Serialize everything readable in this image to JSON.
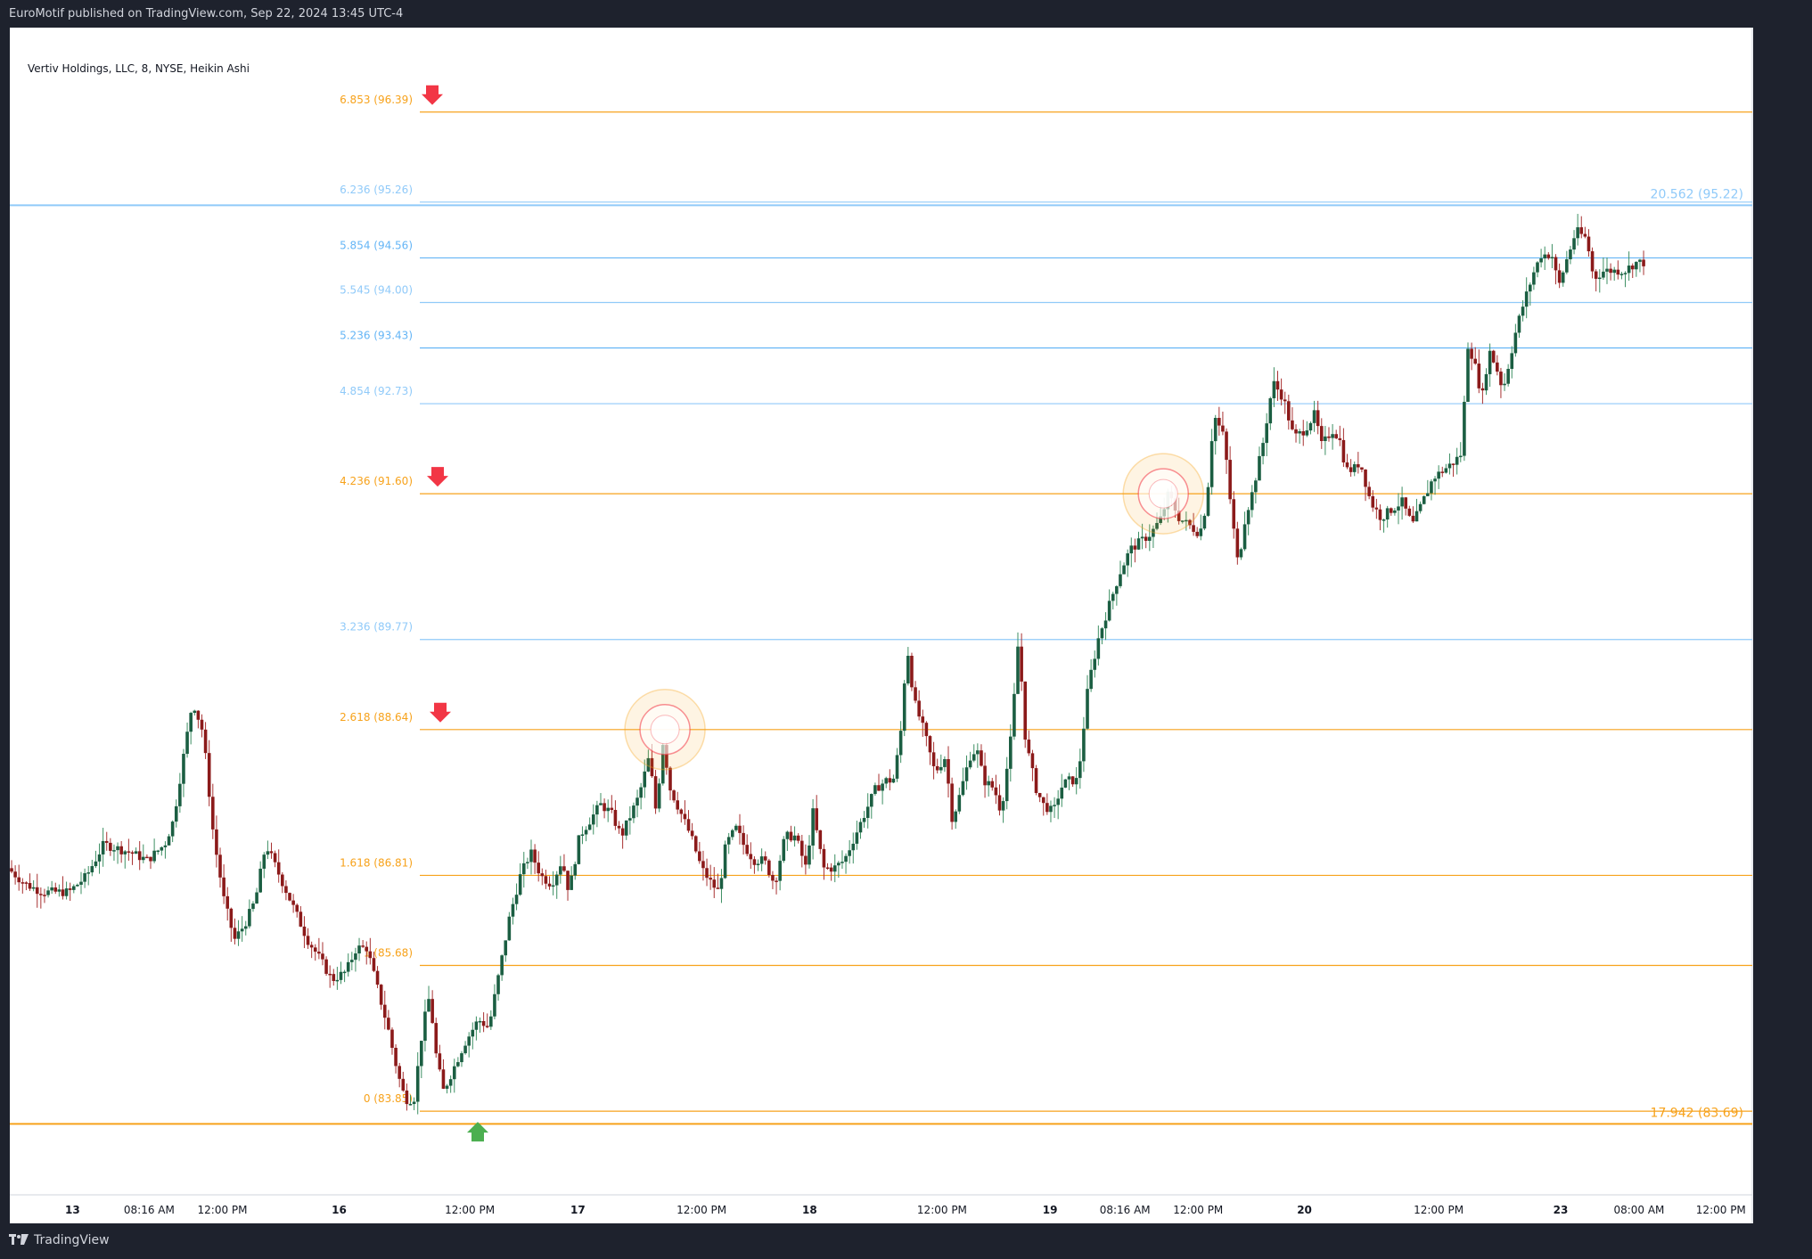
{
  "header": {
    "published_text": "EuroMotif published on TradingView.com, Sep 22, 2024 13:45 UTC-4"
  },
  "footer": {
    "brand": "TradingView",
    "logo_icon": "tradingview-logo-icon"
  },
  "symbol_info": "Vertiv Holdings, LLC, 8, NYSE, Heikin Ashi",
  "colors": {
    "up": "#26a69a",
    "up_dark": "#1b5e42",
    "down": "#8b1a1a",
    "fib_orange": "#f7a21b",
    "fib_blue": "#64b5f6",
    "fib_light_blue": "#90caf9",
    "arrow_red": "#f23645",
    "arrow_green": "#4caf50"
  },
  "chart_data": {
    "type": "candlestick",
    "chart_style": "Heikin Ashi",
    "interval": "8",
    "y_axis": {
      "position": "right",
      "range": [
        82.8,
        97.45
      ],
      "ticks": [
        "97.00",
        "96.50",
        "96.00",
        "95.50",
        "95.00",
        "94.50",
        "94.00",
        "93.50",
        "93.00",
        "92.50",
        "92.00",
        "91.50",
        "91.00",
        "90.50",
        "90.00",
        "89.50",
        "89.00",
        "88.50",
        "88.00",
        "87.50",
        "87.00",
        "86.50",
        "86.00",
        "85.50",
        "85.00",
        "84.50",
        "84.00",
        "83.50",
        "83.00"
      ]
    },
    "x_axis": {
      "ticks": [
        {
          "label": "13",
          "bold": true,
          "pos": 0.036
        },
        {
          "label": "08:16 AM",
          "bold": false,
          "pos": 0.08
        },
        {
          "label": "12:00 PM",
          "bold": false,
          "pos": 0.122
        },
        {
          "label": "16",
          "bold": true,
          "pos": 0.189
        },
        {
          "label": "12:00 PM",
          "bold": false,
          "pos": 0.264
        },
        {
          "label": "17",
          "bold": true,
          "pos": 0.326
        },
        {
          "label": "12:00 PM",
          "bold": false,
          "pos": 0.397
        },
        {
          "label": "18",
          "bold": true,
          "pos": 0.459
        },
        {
          "label": "12:00 PM",
          "bold": false,
          "pos": 0.535
        },
        {
          "label": "19",
          "bold": true,
          "pos": 0.597
        },
        {
          "label": "08:16 AM",
          "bold": false,
          "pos": 0.64
        },
        {
          "label": "12:00 PM",
          "bold": false,
          "pos": 0.682
        },
        {
          "label": "20",
          "bold": true,
          "pos": 0.743
        },
        {
          "label": "12:00 PM",
          "bold": false,
          "pos": 0.82
        },
        {
          "label": "23",
          "bold": true,
          "pos": 0.89
        },
        {
          "label": "08:00 AM",
          "bold": false,
          "pos": 0.935
        },
        {
          "label": "12:00 PM",
          "bold": false,
          "pos": 0.982
        }
      ]
    },
    "price_path": [
      [
        0.0,
        86.9
      ],
      [
        0.01,
        86.7
      ],
      [
        0.02,
        86.6
      ],
      [
        0.035,
        86.6
      ],
      [
        0.045,
        86.8
      ],
      [
        0.055,
        87.2
      ],
      [
        0.07,
        87.1
      ],
      [
        0.08,
        87.0
      ],
      [
        0.09,
        87.2
      ],
      [
        0.095,
        87.5
      ],
      [
        0.1,
        88.2
      ],
      [
        0.106,
        89.0
      ],
      [
        0.112,
        88.6
      ],
      [
        0.118,
        87.3
      ],
      [
        0.124,
        86.5
      ],
      [
        0.13,
        86.0
      ],
      [
        0.136,
        86.2
      ],
      [
        0.142,
        86.5
      ],
      [
        0.148,
        87.2
      ],
      [
        0.154,
        86.9
      ],
      [
        0.16,
        86.6
      ],
      [
        0.166,
        86.3
      ],
      [
        0.172,
        86.0
      ],
      [
        0.178,
        85.8
      ],
      [
        0.186,
        85.5
      ],
      [
        0.194,
        85.6
      ],
      [
        0.2,
        85.9
      ],
      [
        0.206,
        85.9
      ],
      [
        0.212,
        85.4
      ],
      [
        0.218,
        84.9
      ],
      [
        0.224,
        84.3
      ],
      [
        0.228,
        84.0
      ],
      [
        0.233,
        84.0
      ],
      [
        0.238,
        84.9
      ],
      [
        0.242,
        85.3
      ],
      [
        0.246,
        84.5
      ],
      [
        0.25,
        84.1
      ],
      [
        0.256,
        84.4
      ],
      [
        0.262,
        84.7
      ],
      [
        0.27,
        85.0
      ],
      [
        0.276,
        84.9
      ],
      [
        0.282,
        85.6
      ],
      [
        0.288,
        86.3
      ],
      [
        0.294,
        86.8
      ],
      [
        0.3,
        87.1
      ],
      [
        0.306,
        86.8
      ],
      [
        0.312,
        86.7
      ],
      [
        0.318,
        87.0
      ],
      [
        0.322,
        86.6
      ],
      [
        0.328,
        87.3
      ],
      [
        0.334,
        87.5
      ],
      [
        0.34,
        87.7
      ],
      [
        0.346,
        87.6
      ],
      [
        0.352,
        87.3
      ],
      [
        0.356,
        87.5
      ],
      [
        0.362,
        87.8
      ],
      [
        0.368,
        88.3
      ],
      [
        0.372,
        87.6
      ],
      [
        0.376,
        88.5
      ],
      [
        0.38,
        87.9
      ],
      [
        0.386,
        87.6
      ],
      [
        0.392,
        87.3
      ],
      [
        0.398,
        86.9
      ],
      [
        0.404,
        86.7
      ],
      [
        0.408,
        86.6
      ],
      [
        0.412,
        87.2
      ],
      [
        0.418,
        87.4
      ],
      [
        0.422,
        87.2
      ],
      [
        0.428,
        87.0
      ],
      [
        0.434,
        87.0
      ],
      [
        0.44,
        86.7
      ],
      [
        0.446,
        87.3
      ],
      [
        0.452,
        87.3
      ],
      [
        0.458,
        86.9
      ],
      [
        0.462,
        87.6
      ],
      [
        0.468,
        86.9
      ],
      [
        0.474,
        86.9
      ],
      [
        0.48,
        87.0
      ],
      [
        0.486,
        87.3
      ],
      [
        0.492,
        87.6
      ],
      [
        0.498,
        87.9
      ],
      [
        0.504,
        88.0
      ],
      [
        0.508,
        88.0
      ],
      [
        0.512,
        88.5
      ],
      [
        0.516,
        89.7
      ],
      [
        0.52,
        89.0
      ],
      [
        0.526,
        88.6
      ],
      [
        0.532,
        88.1
      ],
      [
        0.538,
        88.3
      ],
      [
        0.542,
        87.5
      ],
      [
        0.546,
        87.8
      ],
      [
        0.552,
        88.3
      ],
      [
        0.556,
        88.4
      ],
      [
        0.56,
        88.0
      ],
      [
        0.566,
        87.9
      ],
      [
        0.57,
        87.6
      ],
      [
        0.576,
        88.6
      ],
      [
        0.58,
        89.8
      ],
      [
        0.584,
        88.5
      ],
      [
        0.59,
        87.9
      ],
      [
        0.594,
        87.7
      ],
      [
        0.6,
        87.6
      ],
      [
        0.604,
        87.9
      ],
      [
        0.608,
        88.0
      ],
      [
        0.614,
        88.0
      ],
      [
        0.62,
        89.2
      ],
      [
        0.626,
        89.8
      ],
      [
        0.632,
        90.2
      ],
      [
        0.638,
        90.6
      ],
      [
        0.644,
        90.9
      ],
      [
        0.65,
        91.0
      ],
      [
        0.656,
        91.1
      ],
      [
        0.662,
        91.3
      ],
      [
        0.666,
        91.6
      ],
      [
        0.672,
        91.3
      ],
      [
        0.678,
        91.2
      ],
      [
        0.684,
        91.1
      ],
      [
        0.688,
        91.5
      ],
      [
        0.692,
        92.6
      ],
      [
        0.698,
        92.3
      ],
      [
        0.702,
        91.4
      ],
      [
        0.706,
        90.7
      ],
      [
        0.71,
        91.3
      ],
      [
        0.714,
        91.6
      ],
      [
        0.72,
        92.2
      ],
      [
        0.726,
        93.0
      ],
      [
        0.732,
        92.8
      ],
      [
        0.738,
        92.3
      ],
      [
        0.744,
        92.4
      ],
      [
        0.75,
        92.6
      ],
      [
        0.754,
        92.2
      ],
      [
        0.76,
        92.4
      ],
      [
        0.764,
        92.3
      ],
      [
        0.768,
        91.9
      ],
      [
        0.772,
        91.9
      ],
      [
        0.776,
        92.0
      ],
      [
        0.782,
        91.5
      ],
      [
        0.788,
        91.3
      ],
      [
        0.794,
        91.4
      ],
      [
        0.8,
        91.5
      ],
      [
        0.806,
        91.2
      ],
      [
        0.812,
        91.5
      ],
      [
        0.818,
        91.8
      ],
      [
        0.824,
        91.9
      ],
      [
        0.83,
        92.0
      ],
      [
        0.834,
        92.1
      ],
      [
        0.838,
        93.5
      ],
      [
        0.842,
        93.2
      ],
      [
        0.846,
        92.8
      ],
      [
        0.85,
        93.4
      ],
      [
        0.854,
        93.2
      ],
      [
        0.858,
        92.9
      ],
      [
        0.862,
        93.3
      ],
      [
        0.866,
        93.7
      ],
      [
        0.87,
        94.0
      ],
      [
        0.876,
        94.4
      ],
      [
        0.88,
        94.6
      ],
      [
        0.886,
        94.6
      ],
      [
        0.89,
        94.2
      ],
      [
        0.894,
        94.5
      ],
      [
        0.9,
        94.9
      ],
      [
        0.906,
        94.8
      ],
      [
        0.91,
        94.3
      ],
      [
        0.916,
        94.4
      ],
      [
        0.922,
        94.4
      ],
      [
        0.928,
        94.4
      ],
      [
        0.934,
        94.5
      ],
      [
        0.938,
        94.5
      ]
    ],
    "fib_levels": [
      {
        "label": "6.853 (96.39)",
        "price": 96.39,
        "color": "orange",
        "arrow": "down"
      },
      {
        "label": "6.236 (95.26)",
        "price": 95.26,
        "color": "light-blue"
      },
      {
        "label": "5.854 (94.56)",
        "price": 94.56,
        "color": "blue"
      },
      {
        "label": "5.545 (94.00)",
        "price": 94.0,
        "color": "light-blue"
      },
      {
        "label": "5.236 (93.43)",
        "price": 93.43,
        "color": "blue"
      },
      {
        "label": "4.854 (92.73)",
        "price": 92.73,
        "color": "light-blue"
      },
      {
        "label": "4.236 (91.60)",
        "price": 91.6,
        "color": "orange",
        "arrow": "down"
      },
      {
        "label": "3.236 (89.77)",
        "price": 89.77,
        "color": "light-blue"
      },
      {
        "label": "2.618 (88.64)",
        "price": 88.64,
        "color": "orange",
        "arrow": "down"
      },
      {
        "label": "1.618 (86.81)",
        "price": 86.81,
        "color": "orange"
      },
      {
        "label": "1 (85.68)",
        "price": 85.68,
        "color": "orange"
      },
      {
        "label": "0 (83.85)",
        "price": 83.85,
        "color": "orange",
        "arrow": "up"
      }
    ],
    "extension_levels": [
      {
        "label": "20.562 (95.22)",
        "price": 95.22,
        "color": "light-blue"
      },
      {
        "label": "17.942 (83.69)",
        "price": 83.69,
        "color": "orange"
      }
    ],
    "highlight_circles": [
      {
        "x": 0.376,
        "price": 88.64
      },
      {
        "x": 0.662,
        "price": 91.6
      }
    ]
  }
}
